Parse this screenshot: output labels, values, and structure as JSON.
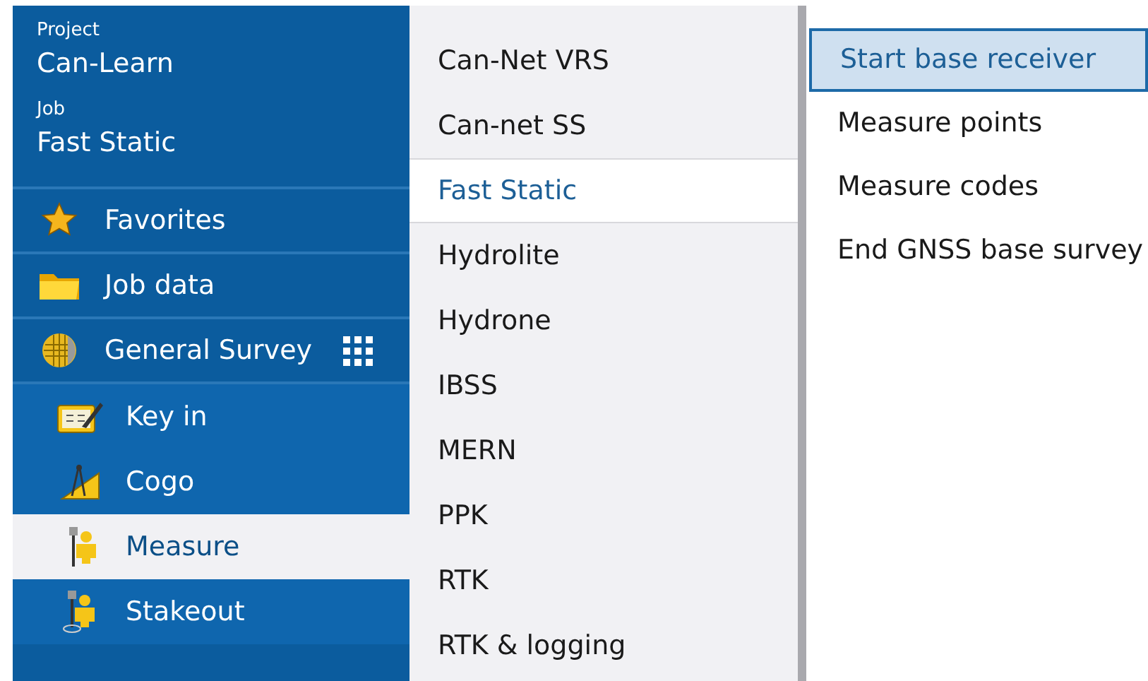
{
  "sidebar": {
    "project_label": "Project",
    "project": "Can-Learn",
    "job_label": "Job",
    "job": "Fast Static",
    "items": [
      {
        "kind": "star",
        "label": "Favorites",
        "selected": false
      },
      {
        "kind": "folder",
        "label": "Job data",
        "selected": false
      },
      {
        "kind": "globe",
        "label": "General Survey",
        "selected": false,
        "expanded": true,
        "children": [
          {
            "kind": "keyin",
            "label": "Key in",
            "selected": false
          },
          {
            "kind": "cogo",
            "label": "Cogo",
            "selected": false
          },
          {
            "kind": "measure",
            "label": "Measure",
            "selected": true
          },
          {
            "kind": "stakeout",
            "label": "Stakeout",
            "selected": false
          }
        ]
      }
    ]
  },
  "styles": [
    {
      "label": "Can-Net VRS",
      "selected": false
    },
    {
      "label": "Can-net SS",
      "selected": false
    },
    {
      "label": "Fast Static",
      "selected": true
    },
    {
      "label": "Hydrolite",
      "selected": false
    },
    {
      "label": "Hydrone",
      "selected": false
    },
    {
      "label": "IBSS",
      "selected": false
    },
    {
      "label": "MERN",
      "selected": false
    },
    {
      "label": "PPK",
      "selected": false
    },
    {
      "label": "RTK",
      "selected": false
    },
    {
      "label": "RTK & logging",
      "selected": false
    }
  ],
  "actions": [
    {
      "label": "Start base receiver",
      "selected": true
    },
    {
      "label": "Measure points",
      "selected": false
    },
    {
      "label": "Measure codes",
      "selected": false
    },
    {
      "label": "End GNSS base survey",
      "selected": false
    }
  ]
}
